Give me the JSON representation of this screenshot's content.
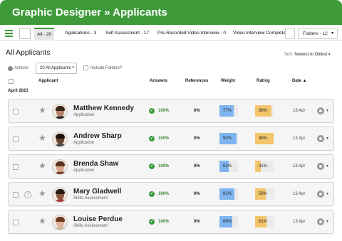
{
  "header": {
    "title": "Graphic Designer » Applicants"
  },
  "tabs": [
    {
      "label": "All - 20",
      "active": true
    },
    {
      "label": "Applications - 3",
      "active": false
    },
    {
      "label": "Self Assessment - 17",
      "active": false
    },
    {
      "label": "Pre-Recorded Video Interview - 0",
      "active": false
    },
    {
      "label": "Video Interview Complete",
      "active": false
    }
  ],
  "folders": {
    "label": "Folders - 12"
  },
  "page_title": "All Applicants",
  "sort": {
    "label": "Sort:",
    "value": "Newest to Oldest"
  },
  "toolbar": {
    "actions_label": "Actions",
    "select_value": "20 All Applicants",
    "include_folders_label": "Include Folders?"
  },
  "columns": {
    "applicant": "Applicant",
    "answers": "Answers",
    "references": "References",
    "weight": "Weight",
    "rating": "Rating",
    "date": "Date ▲"
  },
  "month_label": "April 2021",
  "colors": {
    "brand": "#3f9a3a",
    "weight": "#7fb4f0",
    "rating": "#f3c56a"
  },
  "applicants": [
    {
      "name": "Matthew Kennedy",
      "stage": "Application",
      "badge": "",
      "answers": "100%",
      "references": "0%",
      "weight": 77,
      "weight_label": "77%",
      "rating": 88,
      "rating_label": "88%",
      "date": "13 Apr"
    },
    {
      "name": "Andrew Sharp",
      "stage": "Application",
      "badge": "",
      "answers": "100%",
      "references": "0%",
      "weight": 92,
      "weight_label": "92%",
      "rating": 99,
      "rating_label": "99%",
      "date": "13 Apr"
    },
    {
      "name": "Brenda Shaw",
      "stage": "Application",
      "badge": "",
      "answers": "100%",
      "references": "0%",
      "weight": 51,
      "weight_label": "51%",
      "rating": 31,
      "rating_label": "31%",
      "date": "13 Apr"
    },
    {
      "name": "Mary Gladwell",
      "stage": "Skills Assessment",
      "badge": "1",
      "answers": "100%",
      "references": "0%",
      "weight": 81,
      "weight_label": "81%",
      "rating": 58,
      "rating_label": "58%",
      "date": "13 Apr"
    },
    {
      "name": "Louise Perdue",
      "stage": "Skills Assessment",
      "badge": "",
      "answers": "100%",
      "references": "0%",
      "weight": 69,
      "weight_label": "69%",
      "rating": 61,
      "rating_label": "61%",
      "date": "13 Apr"
    }
  ]
}
